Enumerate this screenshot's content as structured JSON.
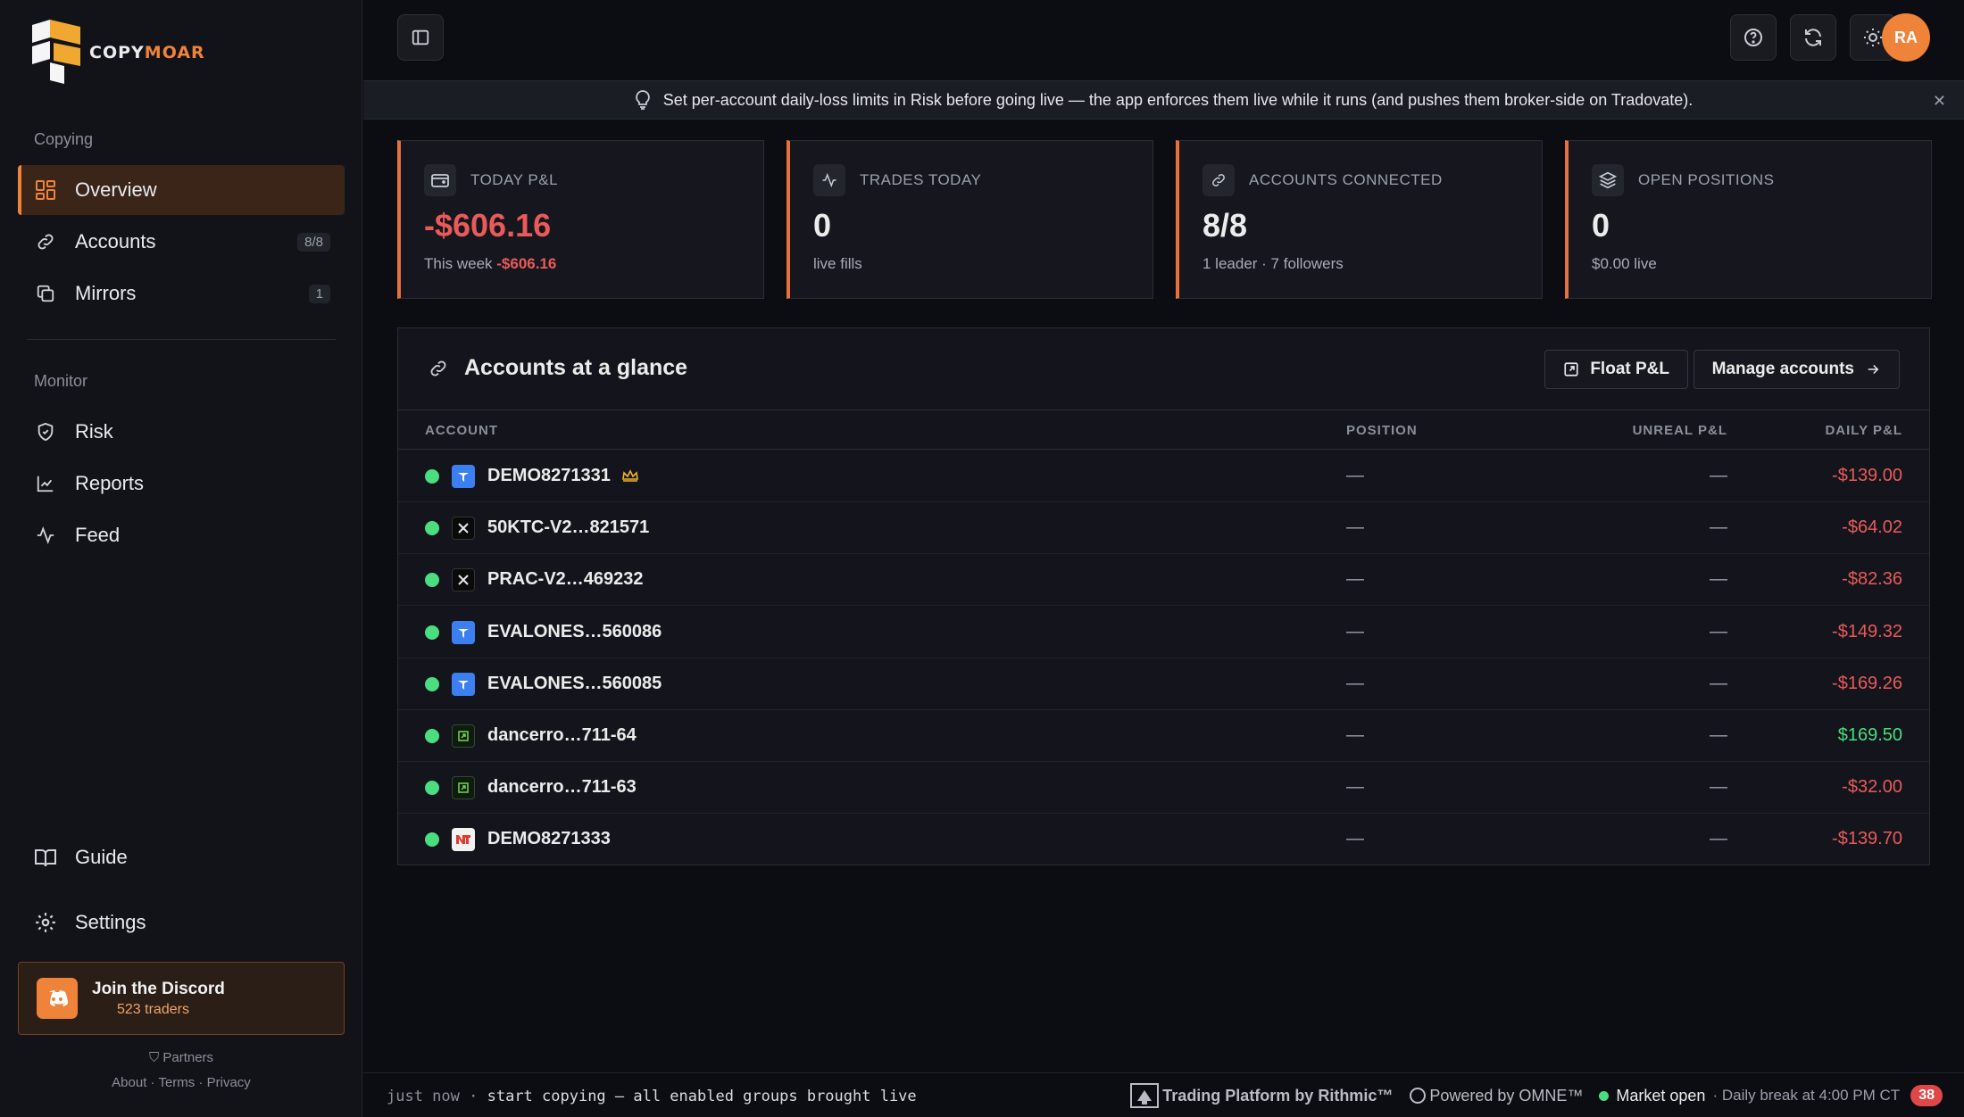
{
  "brand": {
    "name_a": "COPY",
    "name_b": "MOAR"
  },
  "sidebar": {
    "section_copying": "Copying",
    "section_monitor": "Monitor",
    "items": [
      {
        "label": "Overview"
      },
      {
        "label": "Accounts",
        "badge": "8/8"
      },
      {
        "label": "Mirrors",
        "badge": "1"
      },
      {
        "label": "Risk"
      },
      {
        "label": "Reports"
      },
      {
        "label": "Feed"
      }
    ],
    "guide": "Guide",
    "settings": "Settings",
    "discord": {
      "title": "Join the Discord",
      "subtitle": "523 traders"
    },
    "partners": "Partners",
    "links": {
      "about": "About",
      "terms": "Terms",
      "privacy": "Privacy"
    }
  },
  "header": {
    "avatar_initials": "RA"
  },
  "banner": {
    "text": "Set per-account daily-loss limits in Risk before going live — the app enforces them live while it runs (and pushes them broker-side on Tradovate)."
  },
  "stats": [
    {
      "label": "TODAY P&L",
      "value": "-$606.16",
      "sub_prefix": "This week ",
      "sub_value": "-$606.16"
    },
    {
      "label": "TRADES TODAY",
      "value": "0",
      "sub": "live fills"
    },
    {
      "label": "ACCOUNTS CONNECTED",
      "value": "8/8",
      "sub": "1 leader · 7 followers"
    },
    {
      "label": "OPEN POSITIONS",
      "value": "0",
      "sub": "$0.00 live"
    }
  ],
  "panel": {
    "title": "Accounts at a glance",
    "float_btn": "Float P&L",
    "manage_btn": "Manage accounts",
    "columns": {
      "account": "ACCOUNT",
      "position": "POSITION",
      "unreal": "UNREAL P&L",
      "daily": "DAILY P&L"
    },
    "rows": [
      {
        "name": "DEMO8271331",
        "broker": "tradovate",
        "leader": true,
        "position": "—",
        "unreal": "—",
        "daily": "-$139.00",
        "sign": "neg"
      },
      {
        "name": "50KTC-V2…821571",
        "broker": "x",
        "position": "—",
        "unreal": "—",
        "daily": "-$64.02",
        "sign": "neg"
      },
      {
        "name": "PRAC-V2…469232",
        "broker": "x",
        "position": "—",
        "unreal": "—",
        "daily": "-$82.36",
        "sign": "neg"
      },
      {
        "name": "EVALONES…560086",
        "broker": "tradovate",
        "position": "—",
        "unreal": "—",
        "daily": "-$149.32",
        "sign": "neg"
      },
      {
        "name": "EVALONES…560085",
        "broker": "tradovate",
        "position": "—",
        "unreal": "—",
        "daily": "-$169.26",
        "sign": "neg"
      },
      {
        "name": "dancerro…711-64",
        "broker": "green",
        "position": "—",
        "unreal": "—",
        "daily": "$169.50",
        "sign": "pos"
      },
      {
        "name": "dancerro…711-63",
        "broker": "green",
        "position": "—",
        "unreal": "—",
        "daily": "-$32.00",
        "sign": "neg"
      },
      {
        "name": "DEMO8271333",
        "broker": "nt",
        "position": "—",
        "unreal": "—",
        "daily": "-$139.70",
        "sign": "neg"
      }
    ]
  },
  "statusbar": {
    "time": "just now",
    "message": "start copying — all enabled groups brought live",
    "rithmic": "Trading Platform by Rithmic™",
    "omne": "Powered by OMNE™",
    "market": "Market open",
    "break": "· Daily break at 4:00 PM CT",
    "count": "38"
  },
  "colors": {
    "accent": "#f0833a",
    "negative": "#ea5a5a",
    "positive": "#4ade80"
  }
}
